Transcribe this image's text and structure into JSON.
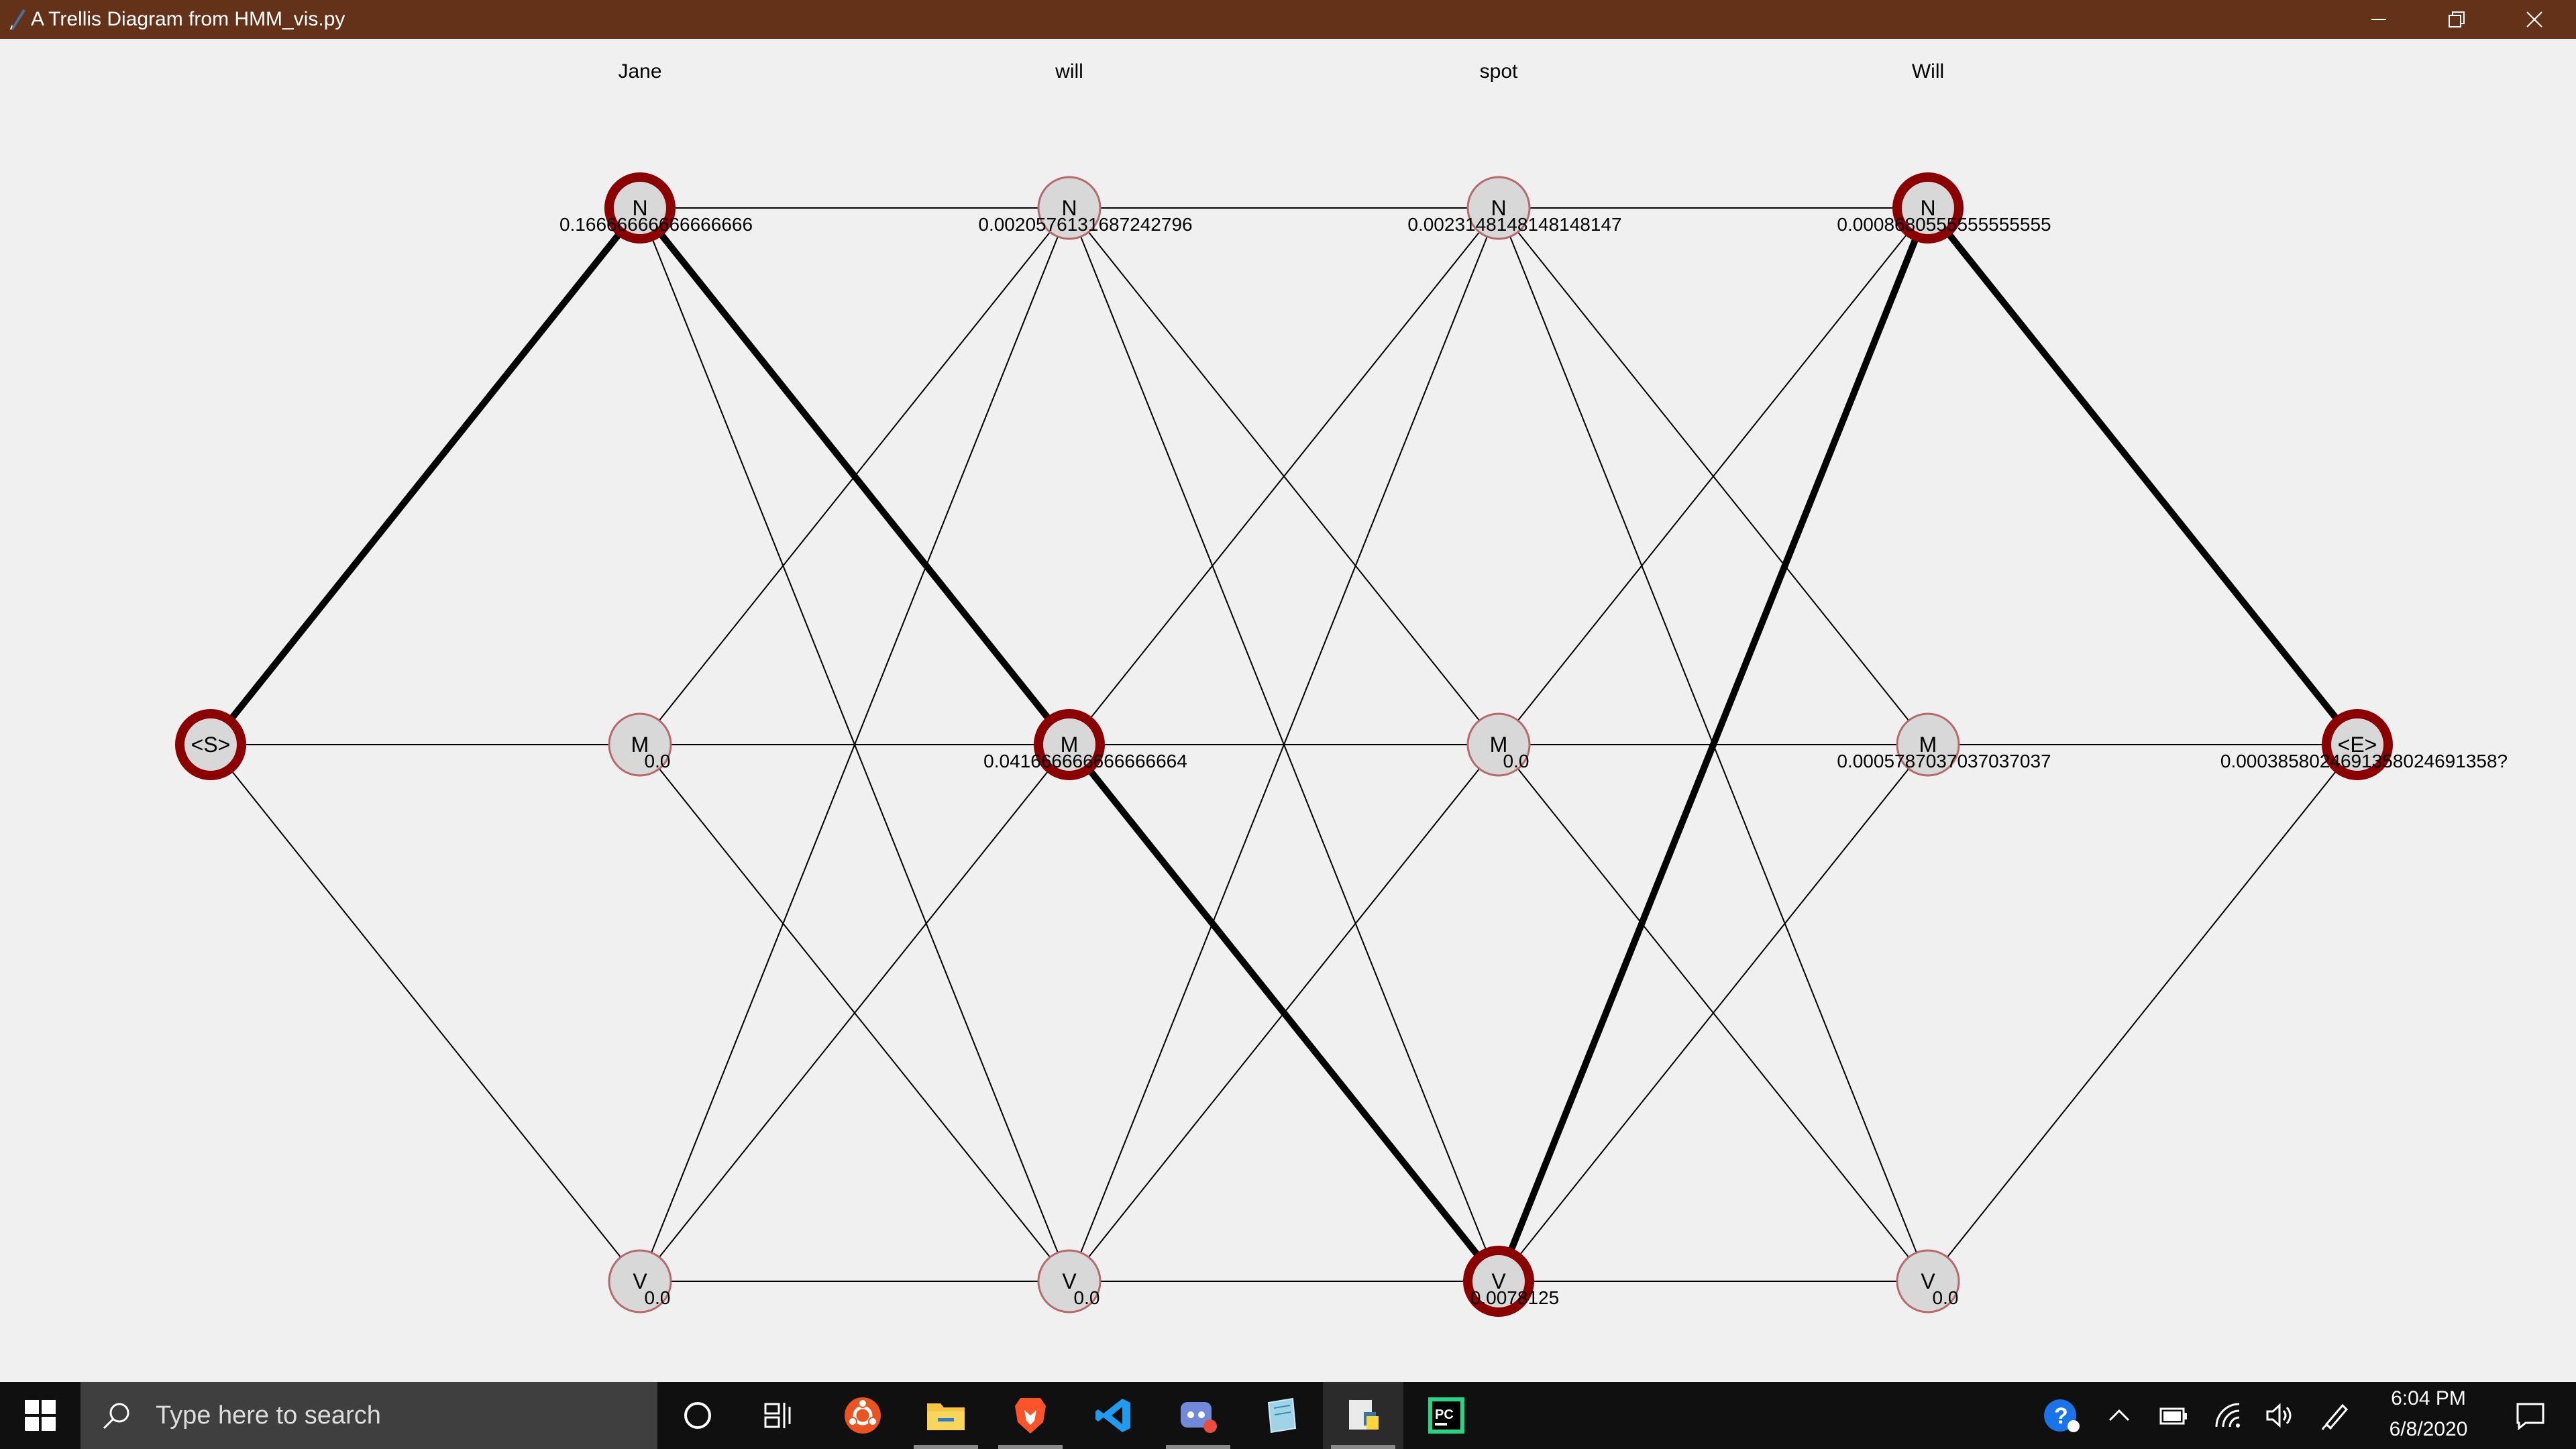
{
  "window": {
    "title": "A Trellis Diagram from HMM_vis.py"
  },
  "trellis": {
    "words": [
      "Jane",
      "will",
      "spot",
      "Will"
    ],
    "states": [
      "N",
      "M",
      "V"
    ],
    "start": {
      "label": "<S>",
      "highlighted": true
    },
    "end": {
      "label": "<E>",
      "highlighted": true,
      "prob": "0.0003858024691358024691358?"
    },
    "nodes": [
      [
        {
          "state": "N",
          "prob": "0.16666666666666666",
          "highlighted": true
        },
        {
          "state": "M",
          "prob": "0.0",
          "highlighted": false
        },
        {
          "state": "V",
          "prob": "0.0",
          "highlighted": false
        }
      ],
      [
        {
          "state": "N",
          "prob": "0.0020576131687242796",
          "highlighted": false
        },
        {
          "state": "M",
          "prob": "0.041666666666666664",
          "highlighted": true
        },
        {
          "state": "V",
          "prob": "0.0",
          "highlighted": false
        }
      ],
      [
        {
          "state": "N",
          "prob": "0.0023148148148148147",
          "highlighted": false
        },
        {
          "state": "M",
          "prob": "0.0",
          "highlighted": false
        },
        {
          "state": "V",
          "prob": "0.0078125",
          "highlighted": true
        }
      ],
      [
        {
          "state": "N",
          "prob": "0.0008680555555555555",
          "highlighted": true
        },
        {
          "state": "M",
          "prob": "0.0005787037037037037",
          "highlighted": false
        },
        {
          "state": "V",
          "prob": "0.0",
          "highlighted": false
        }
      ]
    ],
    "best_path": [
      "<S>",
      "N",
      "M",
      "V",
      "N",
      "<E>"
    ],
    "colors": {
      "node_fill": "#d8d8d8",
      "node_border": "#b76a6a",
      "highlight_border": "#8b0000",
      "edge": "#000000"
    }
  },
  "taskbar": {
    "search_placeholder": "Type here to search",
    "apps": [
      "cortana-icon",
      "task-view-icon",
      "ubuntu-icon",
      "file-explorer-icon",
      "brave-icon",
      "vscode-icon",
      "discord-icon",
      "notepad-icon",
      "python-icon",
      "pycharm-icon"
    ],
    "tray": [
      "help-icon",
      "chevron-up-icon",
      "battery-icon",
      "wifi-icon",
      "volume-icon",
      "pen-icon",
      "notifications-icon"
    ],
    "time": "6:04 PM",
    "date": "6/8/2020"
  }
}
